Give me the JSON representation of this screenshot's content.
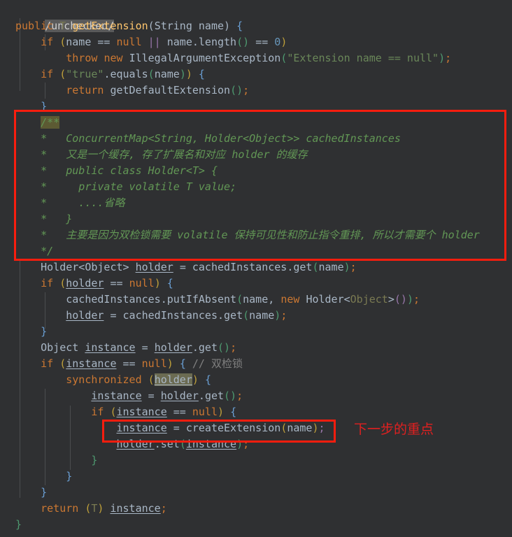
{
  "editor": {
    "background": "#2f3032",
    "language": "java",
    "font_size_px": 15,
    "line_height_px": 23
  },
  "colors": {
    "keyword": "#cc7832",
    "method": "#ffc66d",
    "string": "#6a8759",
    "number": "#6897bb",
    "javadoc": "#629755",
    "comment": "#808080",
    "plain_text": "#a9b7c6",
    "field": "#9876aa",
    "annotation_red": "#f81d0e",
    "search_highlight": "#5a5a5a"
  },
  "lines": [
    {
      "n": 1,
      "indent": 1,
      "text": "/unchecked/",
      "highlighted": true
    },
    {
      "n": 2,
      "indent": 0,
      "text": "public T getExtension(String name) {"
    },
    {
      "n": 3,
      "indent": 1,
      "text": "if (name == null || name.length() == 0)"
    },
    {
      "n": 4,
      "indent": 2,
      "text": "throw new IllegalArgumentException(\"Extension name == null\");"
    },
    {
      "n": 5,
      "indent": 1,
      "text": "if (\"true\".equals(name)) {"
    },
    {
      "n": 6,
      "indent": 2,
      "text": "return getDefaultExtension();"
    },
    {
      "n": 7,
      "indent": 1,
      "text": "}"
    },
    {
      "n": 8,
      "indent": 1,
      "text": "/**"
    },
    {
      "n": 9,
      "indent": 1,
      "text": " *   ConcurrentMap<String, Holder<Object>> cachedInstances"
    },
    {
      "n": 10,
      "indent": 1,
      "text": " *   又是一个缓存, 存了扩展名和对应 holder 的缓存"
    },
    {
      "n": 11,
      "indent": 1,
      "text": " *   public class Holder<T> {"
    },
    {
      "n": 12,
      "indent": 1,
      "text": " *     private volatile T value;"
    },
    {
      "n": 13,
      "indent": 1,
      "text": " *     ....省略"
    },
    {
      "n": 14,
      "indent": 1,
      "text": " *   }"
    },
    {
      "n": 15,
      "indent": 1,
      "text": " *   主要是因为双检锁需要 volatile 保持可见性和防止指令重排, 所以才需要个 holder"
    },
    {
      "n": 16,
      "indent": 1,
      "text": " */"
    },
    {
      "n": 17,
      "indent": 1,
      "text": "Holder<Object> holder = cachedInstances.get(name);"
    },
    {
      "n": 18,
      "indent": 1,
      "text": "if (holder == null) {"
    },
    {
      "n": 19,
      "indent": 2,
      "text": "cachedInstances.putIfAbsent(name, new Holder<Object>());"
    },
    {
      "n": 20,
      "indent": 2,
      "text": "holder = cachedInstances.get(name);"
    },
    {
      "n": 21,
      "indent": 1,
      "text": "}"
    },
    {
      "n": 22,
      "indent": 1,
      "text": "Object instance = holder.get();"
    },
    {
      "n": 23,
      "indent": 1,
      "text": "if (instance == null) { // 双检锁"
    },
    {
      "n": 24,
      "indent": 2,
      "text": "synchronized (holder) {"
    },
    {
      "n": 25,
      "indent": 3,
      "text": "instance = holder.get();"
    },
    {
      "n": 26,
      "indent": 3,
      "text": "if (instance == null) {"
    },
    {
      "n": 27,
      "indent": 4,
      "text": "instance = createExtension(name);"
    },
    {
      "n": 28,
      "indent": 4,
      "text": "holder.set(instance);"
    },
    {
      "n": 29,
      "indent": 3,
      "text": "}"
    },
    {
      "n": 30,
      "indent": 2,
      "text": "}"
    },
    {
      "n": 31,
      "indent": 1,
      "text": "}"
    },
    {
      "n": 32,
      "indent": 1,
      "text": "return (T) instance;"
    },
    {
      "n": 33,
      "indent": 0,
      "text": "}"
    }
  ],
  "annotations": {
    "comment_box_label": "javadoc-comment-highlight-box",
    "create_extension_box_label": "create-extension-highlight-box",
    "note_text": "下一步的重点"
  },
  "highlights": {
    "search_term": "/unchecked/",
    "javadoc_open_token": "/**",
    "synchronized_arg": "holder"
  }
}
